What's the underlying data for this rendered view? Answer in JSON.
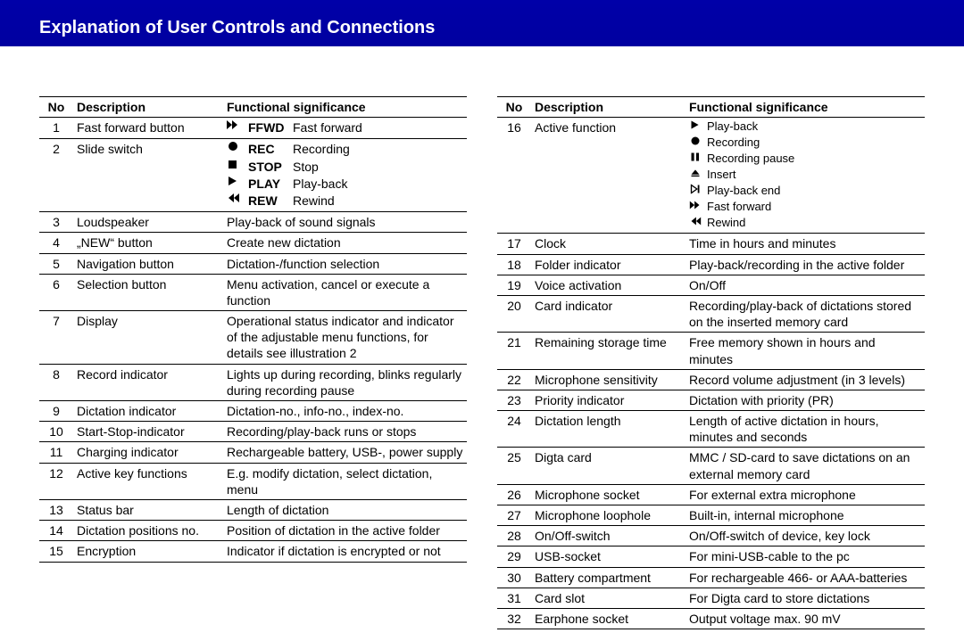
{
  "page_title": "Explanation of User Controls and Connections",
  "headers": {
    "no": "No",
    "desc": "Description",
    "func": "Functional significance"
  },
  "left": [
    {
      "no": "1",
      "desc": "Fast forward button",
      "func": {
        "rows": [
          {
            "icon": "ffwd",
            "bold": "FFWD",
            "text": "Fast forward"
          }
        ]
      }
    },
    {
      "no": "2",
      "desc": "Slide switch",
      "func": {
        "rows": [
          {
            "icon": "rec",
            "bold": "REC",
            "text": "Recording"
          },
          {
            "icon": "stop",
            "bold": "STOP",
            "text": "Stop"
          },
          {
            "icon": "play",
            "bold": "PLAY",
            "text": "Play-back"
          },
          {
            "icon": "rew",
            "bold": "REW",
            "text": "Rewind"
          }
        ]
      }
    },
    {
      "no": "3",
      "desc": "Loudspeaker",
      "func": {
        "text": "Play-back of sound signals"
      }
    },
    {
      "no": "4",
      "desc": "„NEW“ button",
      "func": {
        "text": "Create new dictation"
      }
    },
    {
      "no": "5",
      "desc": "Navigation button",
      "func": {
        "text": "Dictation-/function selection"
      }
    },
    {
      "no": "6",
      "desc": "Selection button",
      "func": {
        "text": "Menu activation, cancel or execute a function"
      }
    },
    {
      "no": "7",
      "desc": "Display",
      "func": {
        "text": "Operational status indicator and indicator of the adjustable menu functions, for details see illustration 2"
      }
    },
    {
      "no": "8",
      "desc": "Record indicator",
      "func": {
        "text": "Lights up during recording, blinks regularly during recording pause"
      }
    },
    {
      "no": "9",
      "desc": "Dictation indicator",
      "func": {
        "text": "Dictation-no., info-no., index-no."
      }
    },
    {
      "no": "10",
      "desc": "Start-Stop-indicator",
      "func": {
        "text": "Recording/play-back runs or stops"
      }
    },
    {
      "no": "11",
      "desc": "Charging indicator",
      "func": {
        "text": "Rechargeable battery, USB-, power supply"
      }
    },
    {
      "no": "12",
      "desc": "Active key functions",
      "func": {
        "text": "E.g. modify dictation, select dictation, menu"
      }
    },
    {
      "no": "13",
      "desc": "Status bar",
      "func": {
        "text": "Length of dictation"
      }
    },
    {
      "no": "14",
      "desc": "Dictation positions no.",
      "func": {
        "text": "Position of dictation in the active folder"
      }
    },
    {
      "no": "15",
      "desc": "Encryption",
      "func": {
        "text": "Indicator if dictation is encrypted or not"
      }
    }
  ],
  "right": [
    {
      "no": "16",
      "desc": "Active function",
      "func": {
        "mini": true,
        "rows": [
          {
            "icon": "play",
            "text": "Play-back"
          },
          {
            "icon": "rec",
            "text": "Recording"
          },
          {
            "icon": "pause",
            "text": "Recording pause"
          },
          {
            "icon": "insert",
            "text": "Insert"
          },
          {
            "icon": "pbend",
            "text": "Play-back end"
          },
          {
            "icon": "ffwd",
            "text": "Fast forward"
          },
          {
            "icon": "rew",
            "text": "Rewind"
          }
        ]
      }
    },
    {
      "no": "17",
      "desc": "Clock",
      "func": {
        "text": "Time in hours and minutes"
      }
    },
    {
      "no": "18",
      "desc": "Folder indicator",
      "func": {
        "text": "Play-back/recording in the active folder"
      }
    },
    {
      "no": "19",
      "desc": "Voice activation",
      "func": {
        "text": "On/Off"
      }
    },
    {
      "no": "20",
      "desc": "Card indicator",
      "func": {
        "text": "Recording/play-back of dictations stored on the inserted memory card"
      }
    },
    {
      "no": "21",
      "desc": "Remaining storage time",
      "func": {
        "text": "Free memory shown in hours and minutes"
      }
    },
    {
      "no": "22",
      "desc": "Microphone sensitivity",
      "func": {
        "text": "Record volume adjustment (in 3 levels)"
      }
    },
    {
      "no": "23",
      "desc": "Priority indicator",
      "func": {
        "text": "Dictation with priority (PR)"
      }
    },
    {
      "no": "24",
      "desc": "Dictation length",
      "func": {
        "text": "Length of active dictation in hours, minutes and seconds"
      }
    },
    {
      "no": "25",
      "desc": "Digta card",
      "func": {
        "text": "MMC / SD-card to save dictations on an external memory card"
      }
    },
    {
      "no": "26",
      "desc": "Microphone socket",
      "func": {
        "text": "For external extra microphone"
      }
    },
    {
      "no": "27",
      "desc": "Microphone loophole",
      "func": {
        "text": "Built-in, internal microphone"
      }
    },
    {
      "no": "28",
      "desc": "On/Off-switch",
      "func": {
        "text": "On/Off-switch of device, key lock"
      }
    },
    {
      "no": "29",
      "desc": "USB-socket",
      "func": {
        "text": "For mini-USB-cable to the pc"
      }
    },
    {
      "no": "30",
      "desc": "Battery compartment",
      "func": {
        "text": "For rechargeable 466- or AAA-batteries"
      }
    },
    {
      "no": "31",
      "desc": "Card slot",
      "func": {
        "text": "For Digta card to store dictations"
      }
    },
    {
      "no": "32",
      "desc": "Earphone socket",
      "func": {
        "text": "Output voltage max. 90 mV"
      }
    }
  ]
}
